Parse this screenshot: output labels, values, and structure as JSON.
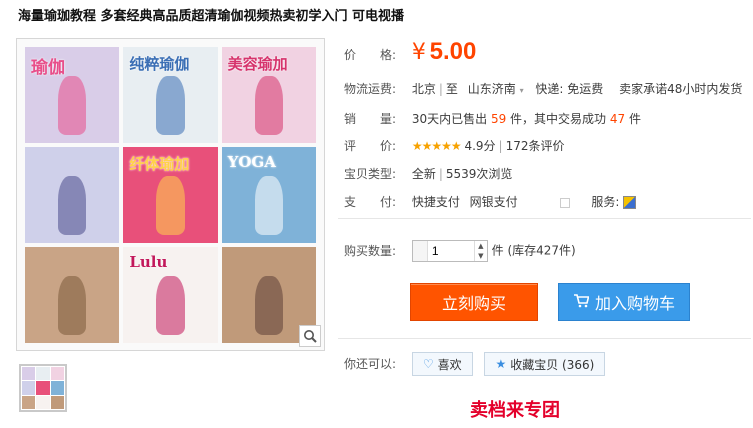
{
  "title": "海量瑜珈教程 多套经典高品质超清瑜伽视频热卖初学入门 可电视播",
  "gallery": {
    "covers": [
      {
        "text": "瑜伽",
        "bg": "#d9cde8"
      },
      {
        "text": "纯粹瑜伽",
        "bg": "#e8eef2"
      },
      {
        "text": "美容瑜加",
        "bg": "#f1d2e2"
      },
      {
        "text": "",
        "bg": "#cfd0ea"
      },
      {
        "text": "纤体瑜加",
        "bg": "#e8507a"
      },
      {
        "text": "YOGA",
        "bg": "#7fb2d8"
      },
      {
        "text": "",
        "bg": "#c9a486"
      },
      {
        "text": "Lulu",
        "bg": "#f7f2f0"
      },
      {
        "text": "",
        "bg": "#c09a7a"
      }
    ]
  },
  "info": {
    "price_label": "价　　格:",
    "price_symbol": "¥",
    "price": "5.00",
    "shipping_label": "物流运费:",
    "ship_from": "北京",
    "ship_to_prefix": "至",
    "ship_to": "山东济南",
    "ship_fee": "快递: 免运费",
    "ship_promise": "卖家承诺48小时内发货",
    "sales_label": "销　　量:",
    "sales_prefix": "30天内已售出",
    "sales_count": "59",
    "sales_mid": "件，其中交易成功",
    "sales_success": "47",
    "sales_unit": "件",
    "rating_label": "评　　价:",
    "rating_stars": "★★★★★",
    "rating_score": "4.9分",
    "reviews": "172条评价",
    "type_label": "宝贝类型:",
    "item_type": "全新",
    "views": "5539次浏览",
    "pay_label": "支　　付:",
    "pay1": "快捷支付",
    "pay2": "网银支付",
    "service_label": "服务:",
    "qty_label": "购买数量:",
    "qty_value": "1",
    "stock": "件 (库存427件)",
    "buy_now": "立刻购买",
    "add_cart": "加入购物车",
    "also_label": "你还可以:",
    "like": "喜欢",
    "favorite": "收藏宝贝 (366)"
  },
  "footer": {
    "red_text": "卖档来专团"
  },
  "colors": {
    "accent": "#ff4400",
    "buy": "#ff5400",
    "cart": "#3a9bea"
  }
}
